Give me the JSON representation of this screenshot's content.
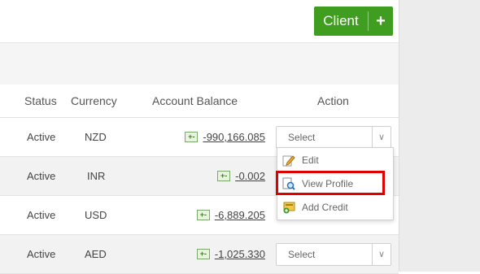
{
  "header": {
    "client_button_label": "Client",
    "client_plus_label": "+"
  },
  "table": {
    "columns": {
      "status": "Status",
      "currency": "Currency",
      "balance": "Account Balance",
      "action": "Action"
    },
    "rows": [
      {
        "status": "Active",
        "currency": "NZD",
        "balance": "-990,166.085",
        "action": "Select"
      },
      {
        "status": "Active",
        "currency": "INR",
        "balance": "-0.002"
      },
      {
        "status": "Active",
        "currency": "USD",
        "balance": "-6,889.205"
      },
      {
        "status": "Active",
        "currency": "AED",
        "balance": "-1,025.330",
        "action": "Select"
      }
    ]
  },
  "dropdown": {
    "items": [
      {
        "label": "Edit",
        "icon": "edit-icon"
      },
      {
        "label": "View Profile",
        "icon": "view-profile-icon"
      },
      {
        "label": "Add Credit",
        "icon": "add-credit-icon"
      }
    ],
    "highlight_color": "#e00000"
  },
  "colors": {
    "accent": "#3f9e1f"
  }
}
